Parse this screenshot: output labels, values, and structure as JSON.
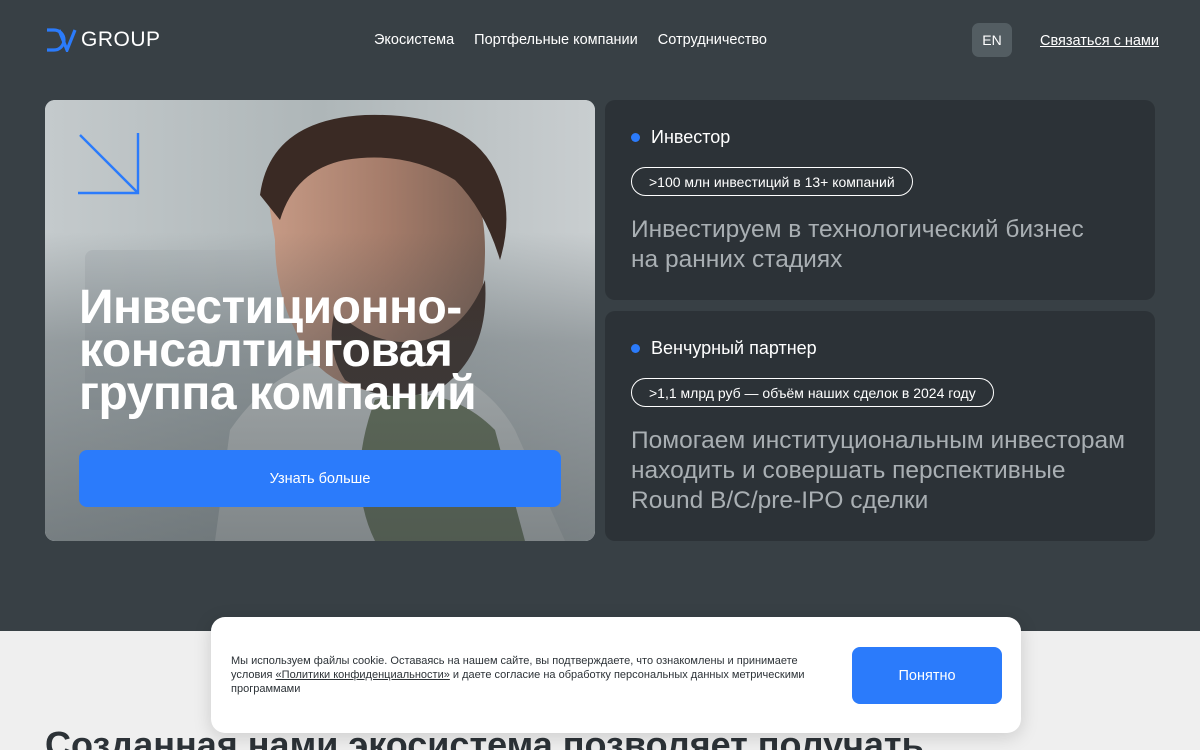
{
  "header": {
    "logo_text": "GROUP",
    "nav": [
      "Экосистема",
      "Портфельные компании",
      "Сотрудничество"
    ],
    "lang": "EN",
    "contact": "Связаться с нами"
  },
  "hero": {
    "title": "Инвестиционно-консалтинговая группа компаний",
    "button": "Узнать больше"
  },
  "cards": [
    {
      "label": "Инвестор",
      "pill": ">100 млн инвестиций в 13+ компаний",
      "text": "Инвестируем в технологический бизнес на ранних стадиях"
    },
    {
      "label": "Венчурный партнер",
      "pill": ">1,1 млрд руб — объём наших сделок в 2024 году",
      "text": "Помогаем институциональным инвесторам находить и совершать перспективные Round B/C/pre-IPO сделки"
    }
  ],
  "cookie": {
    "text_before": "Мы используем файлы cookie. Оставаясь на нашем сайте, вы подтверждаете, что ознакомлены и принимаете условия ",
    "link": "«Политики конфиденциальности»",
    "text_after": " и даете согласие на обработку персональных данных метрическими программами",
    "button": "Понятно"
  },
  "section_title": "Созданная нами экосистема позволяет получать",
  "colors": {
    "background": "#384045",
    "card": "#2c3237",
    "accent": "#2b7bfb",
    "lower_background": "#efefef"
  },
  "icons": {
    "hero_arrow": "arrow-down-right-icon",
    "card_marker": "blue-dot-icon"
  }
}
